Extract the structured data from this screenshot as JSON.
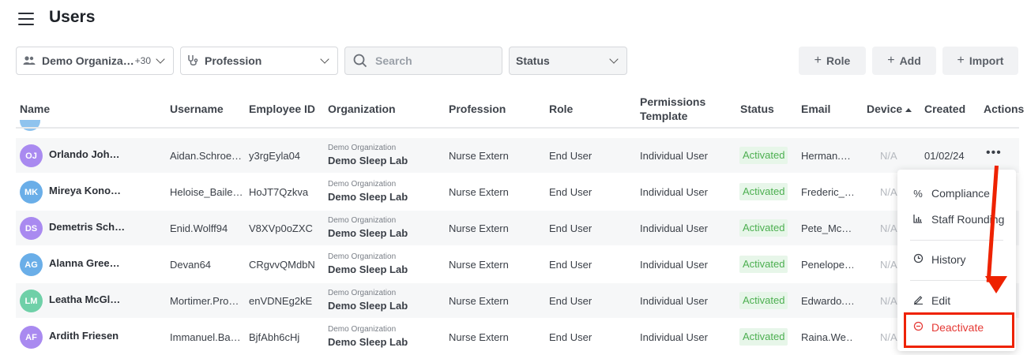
{
  "header": {
    "title": "Users"
  },
  "filters": {
    "organization": {
      "label": "Demo Organiza…",
      "count": "+30"
    },
    "profession": {
      "label": "Profession"
    },
    "search": {
      "placeholder": "Search"
    },
    "status": {
      "label": "Status"
    }
  },
  "actions": {
    "role": "Role",
    "add": "Add",
    "import": "Import"
  },
  "table": {
    "columns": {
      "name": "Name",
      "username": "Username",
      "employee_id": "Employee ID",
      "organization": "Organization",
      "profession": "Profession",
      "role": "Role",
      "permissions_line1": "Permissions",
      "permissions_line2": "Template",
      "status": "Status",
      "email": "Email",
      "device": "Device",
      "created": "Created",
      "actions": "Actions"
    },
    "rows": [
      {
        "initials": "OJ",
        "avatar_color": "#a98af0",
        "name": "Orlando Joh…",
        "username": "Aidan.Schroe…",
        "employee_id": "y3rgEyla04",
        "org_parent": "Demo Organization",
        "org": "Demo Sleep Lab",
        "profession": "Nurse Extern",
        "role": "End User",
        "template": "Individual User",
        "status": "Activated",
        "email": "Herman.…",
        "device": "N/A",
        "created": "01/02/24"
      },
      {
        "initials": "MK",
        "avatar_color": "#6aaee8",
        "name": "Mireya Kono…",
        "username": "Heloise_Baile…",
        "employee_id": "HoJT7Qzkva",
        "org_parent": "Demo Organization",
        "org": "Demo Sleep Lab",
        "profession": "Nurse Extern",
        "role": "End User",
        "template": "Individual User",
        "status": "Activated",
        "email": "Frederic_…",
        "device": "N/A",
        "created": ""
      },
      {
        "initials": "DS",
        "avatar_color": "#a98af0",
        "name": "Demetris Sch…",
        "username": "Enid.Wolff94",
        "employee_id": "V8XVp0oZXC",
        "org_parent": "Demo Organization",
        "org": "Demo Sleep Lab",
        "profession": "Nurse Extern",
        "role": "End User",
        "template": "Individual User",
        "status": "Activated",
        "email": "Pete_Mc…",
        "device": "N/A",
        "created": ""
      },
      {
        "initials": "AG",
        "avatar_color": "#6aaee8",
        "name": "Alanna Gree…",
        "username": "Devan64",
        "employee_id": "CRgvvQMdbN",
        "org_parent": "Demo Organization",
        "org": "Demo Sleep Lab",
        "profession": "Nurse Extern",
        "role": "End User",
        "template": "Individual User",
        "status": "Activated",
        "email": "Penelope…",
        "device": "N/A",
        "created": ""
      },
      {
        "initials": "LM",
        "avatar_color": "#6fd0a8",
        "name": "Leatha McGl…",
        "username": "Mortimer.Pro…",
        "employee_id": "enVDNEg2kE",
        "org_parent": "Demo Organization",
        "org": "Demo Sleep Lab",
        "profession": "Nurse Extern",
        "role": "End User",
        "template": "Individual User",
        "status": "Activated",
        "email": "Edwardo.…",
        "device": "N/A",
        "created": ""
      },
      {
        "initials": "AF",
        "avatar_color": "#a98af0",
        "name": "Ardith Friesen",
        "username": "Immanuel.Ba…",
        "employee_id": "BjfAbh6cHj",
        "org_parent": "Demo Organization",
        "org": "Demo Sleep Lab",
        "profession": "Nurse Extern",
        "role": "End User",
        "template": "Individual User",
        "status": "Activated",
        "email": "Raina.We…",
        "device": "N/A",
        "created": ""
      }
    ]
  },
  "row_menu": {
    "compliance": "Compliance",
    "staff_rounding": "Staff Rounding",
    "history": "History",
    "edit": "Edit",
    "deactivate": "Deactivate"
  },
  "colors": {
    "accent_red": "#ee2200",
    "activated": "#4caf50",
    "danger": "#e53935"
  }
}
